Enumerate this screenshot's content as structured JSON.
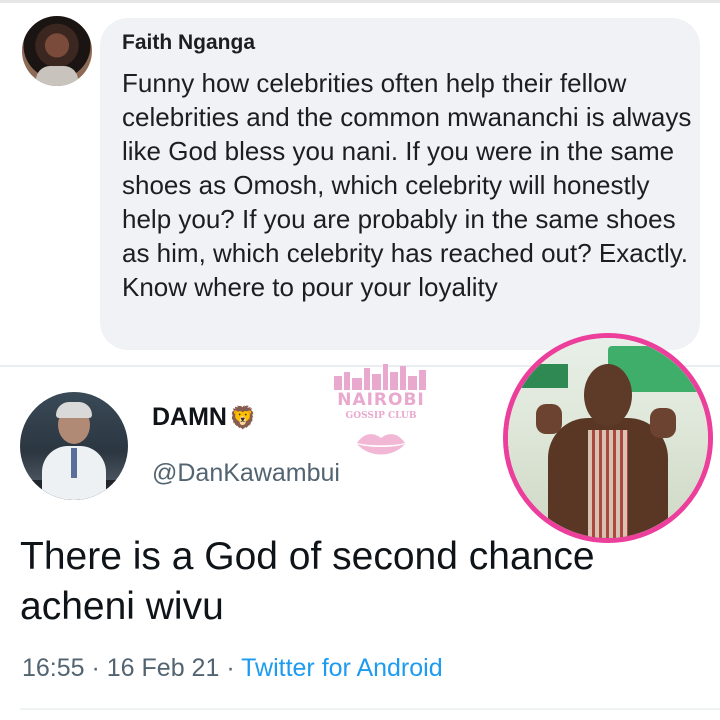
{
  "facebook_comment": {
    "author": "Faith Nganga",
    "text": "Funny how celebrities often help their fellow celebrities and the common mwananchi is always like God bless you nani. If you were in the same shoes as Omosh, which celebrity will honestly help you? If you are probably in the same shoes as him, which celebrity has reached out? Exactly. Know where to pour your loyality"
  },
  "watermark": {
    "title": "NAIROBI",
    "subtitle": "GOSSIP CLUB"
  },
  "tweet": {
    "display_name": "DAMN",
    "name_emoji": "🦁",
    "handle": "@DanKawambui",
    "text": "There is a God of second chance acheni wivu",
    "time": "16:55",
    "separator": " · ",
    "date": "16 Feb 21",
    "app": "Twitter for Android"
  },
  "colors": {
    "bubble": "#f0f2f5",
    "link_blue": "#1d9bf0",
    "inset_border": "#ec3e9b",
    "watermark_pink": "#e9a8cd"
  },
  "icons": [
    "lion-emoji-icon",
    "lips-icon",
    "city-skyline-icon"
  ]
}
